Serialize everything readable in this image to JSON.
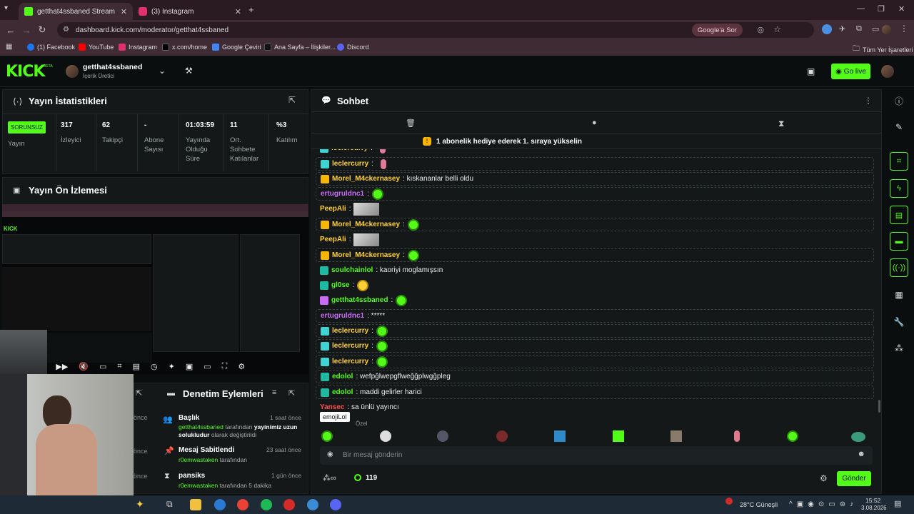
{
  "browser": {
    "tabs": [
      {
        "title": "getthat4ssbaned Stream - Kick",
        "color": "#53fc18"
      },
      {
        "title": "(3) Instagram",
        "color": "#e1306c"
      }
    ],
    "url": "dashboard.kick.com/moderator/getthat4ssbaned",
    "google_sor": "Google'a Sor",
    "bookmarks": [
      {
        "label": "(1) Facebook",
        "color": "#1877f2"
      },
      {
        "label": "YouTube",
        "color": "#ff0000"
      },
      {
        "label": "Instagram",
        "color": "#e1306c"
      },
      {
        "label": "x.com/home",
        "color": "#222222"
      },
      {
        "label": "Google Çeviri",
        "color": "#4285f4"
      },
      {
        "label": "Ana Sayfa – İlişkiler...",
        "color": "#111111"
      },
      {
        "label": "Discord",
        "color": "#5865f2"
      }
    ],
    "all_bookmarks": "Tüm Yer İşaretleri"
  },
  "header": {
    "logo": "KICK",
    "beta": "BETA",
    "channel_name": "getthat4ssbaned",
    "channel_role": "İçerik Üretici",
    "go_live": "Go live"
  },
  "stats": {
    "title": "Yayın İstatistikleri",
    "status_badge": "SORUNSUZ",
    "status_label": "Yayın",
    "items": [
      {
        "value": "317",
        "label": "İzleyici"
      },
      {
        "value": "62",
        "label": "Takipçi"
      },
      {
        "value": "-",
        "label": "Abone Sayısı"
      },
      {
        "value": "01:03:59",
        "label": "Yayında Olduğu Süre"
      },
      {
        "value": "11",
        "label": "Ort. Sohbete Katılanlar"
      },
      {
        "value": "%3",
        "label": "Katılım"
      }
    ]
  },
  "preview": {
    "title": "Yayın Ön İzlemesi"
  },
  "moderation": {
    "title": "Denetim Eylemleri",
    "items": [
      {
        "title": "Başlık",
        "time": "1 saat önce",
        "actor": "getthat4ssbaned",
        "text1": " tarafından ",
        "bold": "yayinimiz uzun solukludur",
        "text2": " olarak değiştirildi"
      },
      {
        "title": "Mesaj Sabitlendi",
        "time": "23 saat önce",
        "actor": "r0emwastaken",
        "text1": " tarafından",
        "bold": "",
        "text2": ""
      },
      {
        "title": "pansiks",
        "time": "1 gün önce",
        "actor": "r0emwastaken",
        "text1": " tarafından 5 dakika",
        "bold": "",
        "text2": ""
      }
    ],
    "side_times": [
      "önce",
      "önce",
      "önce"
    ]
  },
  "chat": {
    "title": "Sohbet",
    "banner": "1 abonelik hediye ederek 1. sıraya yükselin",
    "messages": [
      {
        "user": "leclercurry",
        "color": "#ffd036",
        "text": "",
        "badge": "#3fd4d4",
        "emote": "pink"
      },
      {
        "user": "leclercurry",
        "color": "#ffd036",
        "text": "",
        "badge": "#3fd4d4",
        "emote": "pink"
      },
      {
        "user": "Morel_M4ckernasey",
        "color": "#ffd036",
        "text": ": kıskananlar belli oldu",
        "badge": "#f5b500",
        "emote": ""
      },
      {
        "user": "ertugruldnc1",
        "color": "#c86cf6",
        "text": "",
        "badge": "",
        "emote": "green"
      },
      {
        "user": "PeepAli",
        "color": "#ffd036",
        "text": "",
        "badge": "",
        "emote": "img"
      },
      {
        "user": "Morel_M4ckernasey",
        "color": "#ffd036",
        "text": "",
        "badge": "#f5b500",
        "emote": "green"
      },
      {
        "user": "PeepAli",
        "color": "#ffd036",
        "text": "",
        "badge": "",
        "emote": "img"
      },
      {
        "user": "Morel_M4ckernasey",
        "color": "#ffd036",
        "text": "",
        "badge": "#f5b500",
        "emote": "green"
      },
      {
        "user": "soulchainlol",
        "color": "#53fc18",
        "text": ": kaoriyi moglamışsın",
        "badge": "#1fb8a0",
        "emote": ""
      },
      {
        "user": "gl0se",
        "color": "#53fc18",
        "text": "",
        "badge": "#1fb8a0",
        "emote": "yellow"
      },
      {
        "user": "getthat4ssbaned",
        "color": "#53fc18",
        "text": "",
        "badge": "#c86cf6",
        "emote": "green"
      },
      {
        "user": "ertugruldnc1",
        "color": "#c86cf6",
        "text": ": *****",
        "badge": "",
        "emote": ""
      },
      {
        "user": "leclercurry",
        "color": "#ffd036",
        "text": "",
        "badge": "#3fd4d4",
        "emote": "green"
      },
      {
        "user": "leclercurry",
        "color": "#ffd036",
        "text": "",
        "badge": "#3fd4d4",
        "emote": "green"
      },
      {
        "user": "leclercurry",
        "color": "#ffd036",
        "text": "",
        "badge": "#3fd4d4",
        "emote": "green"
      },
      {
        "user": "edolol",
        "color": "#53fc18",
        "text": ": wefpğlwepgflweğğplwgğpleg",
        "badge": "#1fb8a0",
        "emote": ""
      },
      {
        "user": "edolol",
        "color": "#53fc18",
        "text": ": maddi gelirler harici",
        "badge": "#1fb8a0",
        "emote": ""
      },
      {
        "user": "Yansec",
        "color": "#ff4d4d",
        "text": ": sa ünlü yayıncı",
        "badge": "",
        "emote": ""
      }
    ],
    "tooltip": "emojiLol",
    "emote_tab": "Özel",
    "input_placeholder": "Bir mesaj gönderin",
    "points": "119",
    "send": "Gönder"
  },
  "taskbar": {
    "weather": "28°C  Güneşli",
    "time": "15:52",
    "date": "3.08.2026"
  }
}
